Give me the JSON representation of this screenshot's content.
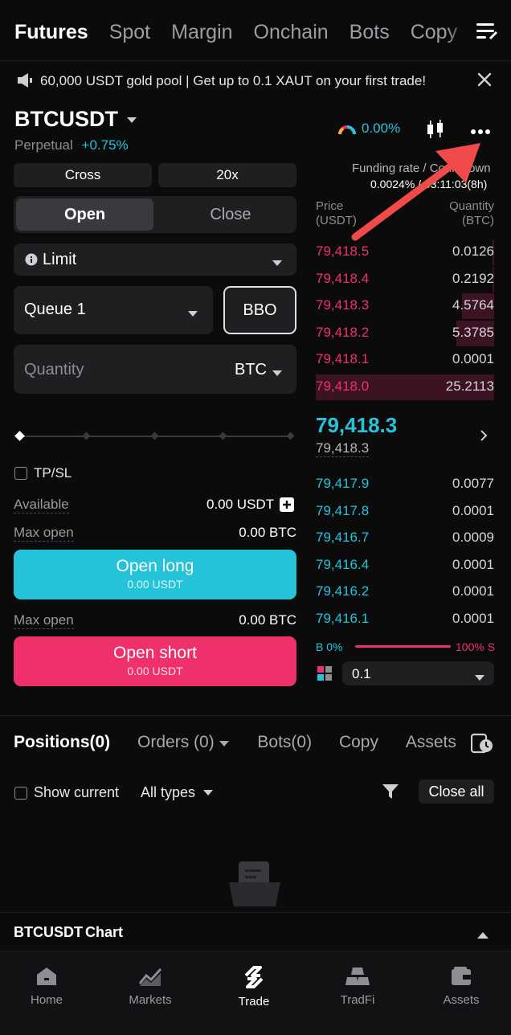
{
  "top_tabs": [
    "Futures",
    "Spot",
    "Margin",
    "Onchain",
    "Bots",
    "Copy"
  ],
  "banner": {
    "text": "60,000 USDT gold pool | Get up to 0.1 XAUT on your first trade!"
  },
  "symbol": {
    "name": "BTCUSDT",
    "type": "Perpetual",
    "change": "+0.75%",
    "sentiment": "0.00%"
  },
  "funding": {
    "label": "Funding rate / Countdown",
    "value": "0.0024% / 03:11:03(8h)"
  },
  "order": {
    "margin_mode": "Cross",
    "leverage": "20x",
    "open_tab": "Open",
    "close_tab": "Close",
    "order_type": "Limit",
    "queue": "Queue 1",
    "bbo": "BBO",
    "quantity_placeholder": "Quantity",
    "quantity_unit": "BTC",
    "tpsl": "TP/SL",
    "available_label": "Available",
    "available_value": "0.00 USDT",
    "max_open_label": "Max open",
    "max_open_long": "0.00 BTC",
    "max_open_short": "0.00 BTC",
    "open_long": "Open long",
    "open_long_sub": "0.00 USDT",
    "open_short": "Open short",
    "open_short_sub": "0.00 USDT",
    "slider_level_percent": 0
  },
  "orderbook": {
    "price_header": "Price",
    "price_unit": "(USDT)",
    "qty_header": "Quantity",
    "qty_unit": "(BTC)",
    "asks": [
      {
        "price": "79,418.5",
        "qty": "0.0126",
        "depth": 0.01
      },
      {
        "price": "79,418.4",
        "qty": "0.2192",
        "depth": 0.01
      },
      {
        "price": "79,418.3",
        "qty": "4.5764",
        "depth": 0.18
      },
      {
        "price": "79,418.2",
        "qty": "5.3785",
        "depth": 0.21
      },
      {
        "price": "79,418.1",
        "qty": "0.0001",
        "depth": 0.0
      },
      {
        "price": "79,418.0",
        "qty": "25.2113",
        "depth": 1.0
      }
    ],
    "last_price": "79,418.3",
    "mark_price": "79,418.3",
    "bids": [
      {
        "price": "79,417.9",
        "qty": "0.0077"
      },
      {
        "price": "79,417.8",
        "qty": "0.0001"
      },
      {
        "price": "79,416.7",
        "qty": "0.0009"
      },
      {
        "price": "79,416.4",
        "qty": "0.0001"
      },
      {
        "price": "79,416.2",
        "qty": "0.0001"
      },
      {
        "price": "79,416.1",
        "qty": "0.0001"
      }
    ],
    "buy_ratio": "B 0%",
    "sell_ratio": "100% S",
    "precision": "0.1"
  },
  "positions": {
    "tabs": [
      "Positions(0)",
      "Orders (0)",
      "Bots(0)",
      "Copy",
      "Assets"
    ],
    "show_current": "Show current",
    "all_types": "All types",
    "close_all": "Close all"
  },
  "chart_bar": {
    "symbol": "BTCUSDT",
    "label": "Chart"
  },
  "bottom_nav": [
    "Home",
    "Markets",
    "Trade",
    "TradFi",
    "Assets"
  ],
  "colors": {
    "teal": "#25c3d9",
    "pink": "#f0306b",
    "arrow": "#f04a4a"
  }
}
